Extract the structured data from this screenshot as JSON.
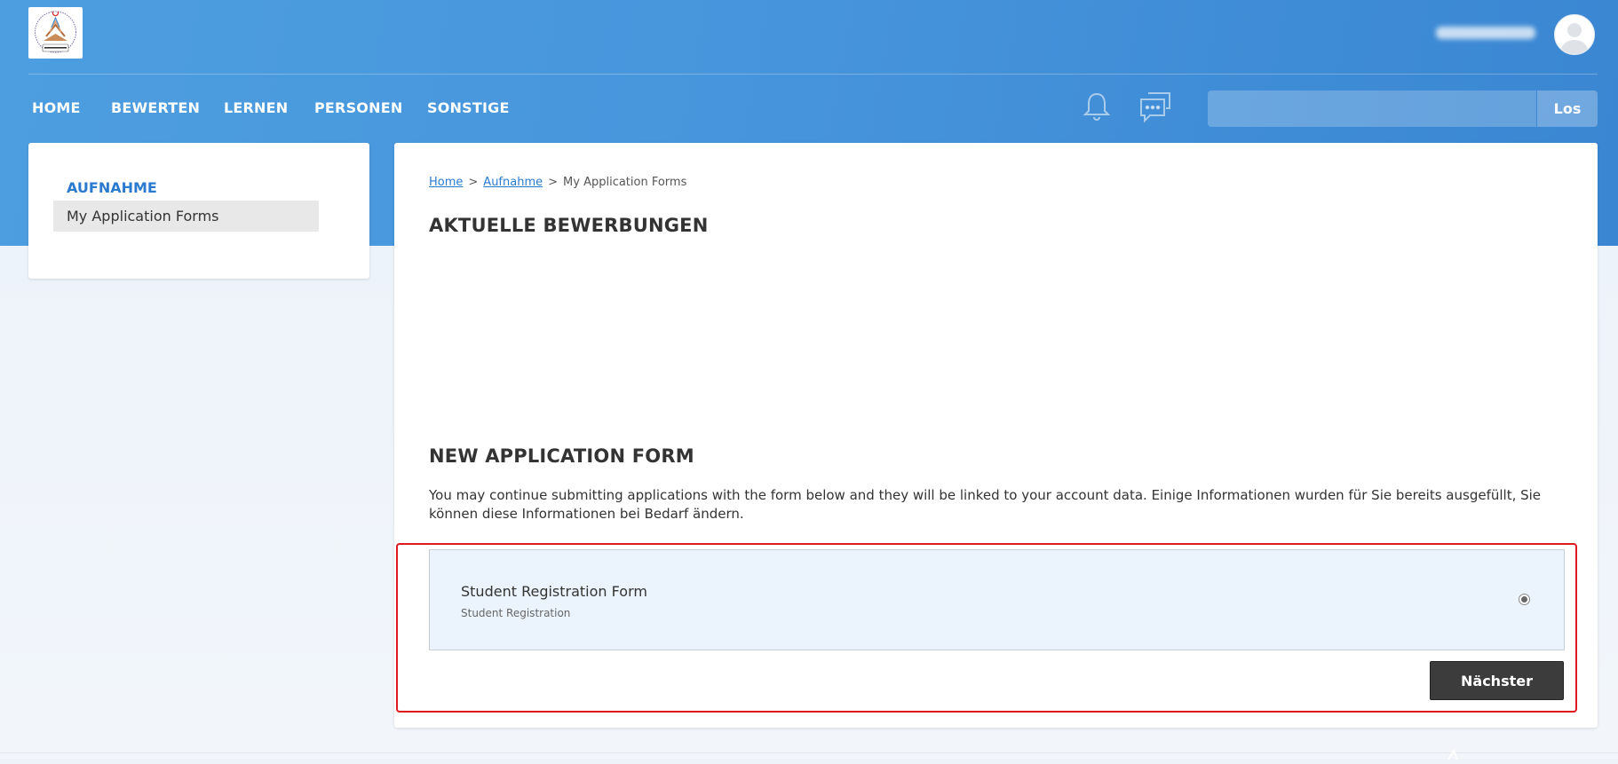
{
  "header": {
    "logo_icon": "school-logo-icon",
    "avatar_icon": "user-avatar-icon"
  },
  "nav": {
    "items": [
      {
        "label": "HOME"
      },
      {
        "label": "BEWERTEN"
      },
      {
        "label": "LERNEN"
      },
      {
        "label": "PERSONEN"
      },
      {
        "label": "SONSTIGE"
      }
    ],
    "notification_icon": "bell-icon",
    "messages_icon": "chat-icon",
    "search": {
      "value": "",
      "placeholder": "",
      "button_label": "Los"
    }
  },
  "sidebar": {
    "heading": "AUFNAHME",
    "items": [
      {
        "label": "My Application Forms",
        "active": true
      }
    ]
  },
  "main": {
    "breadcrumb": [
      {
        "label": "Home",
        "link": true
      },
      {
        "label": "Aufnahme",
        "link": true
      },
      {
        "label": "My Application Forms",
        "link": false
      }
    ],
    "current_title": "AKTUELLE BEWERBUNGEN",
    "new_title": "NEW APPLICATION FORM",
    "description": "You may continue submitting applications with the form below and they will be linked to your account data. Einige Informationen wurden für Sie bereits ausgefüllt, Sie können diese Informationen bei Bedarf ändern.",
    "forms": [
      {
        "title": "Student Registration Form",
        "subtitle": "Student Registration",
        "selected": true
      }
    ],
    "next_button": "Nächster"
  },
  "colors": {
    "header_blue": "#4795dc",
    "link_blue": "#2a7bd0",
    "highlight_red": "#e0191e",
    "button_dark": "#3c3c3c",
    "option_bg": "#ebf4fc"
  }
}
